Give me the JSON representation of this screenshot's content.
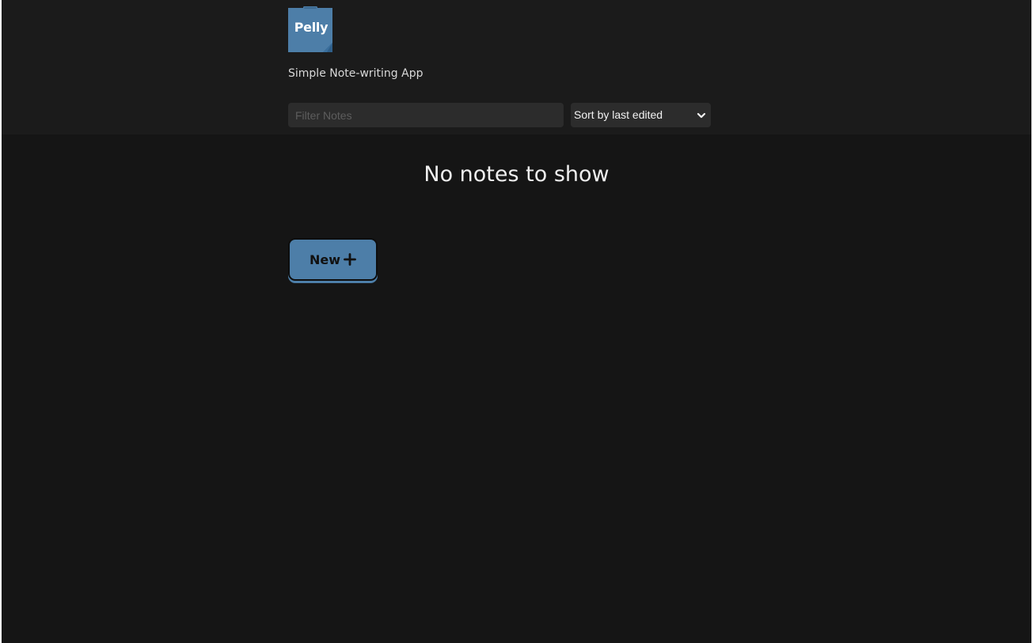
{
  "header": {
    "logo_text": "Pelly",
    "subtitle": "Simple Note-writing App"
  },
  "filter": {
    "placeholder": "Filter Notes",
    "value": ""
  },
  "sort": {
    "selected": "Sort by last edited"
  },
  "main": {
    "empty_message": "No notes to show",
    "new_button_label": "New"
  },
  "icons": {
    "logo": "pelly-logo-icon",
    "new": "plus-icon",
    "dropdown": "chevron-down-icon"
  },
  "colors": {
    "accent": "#4d7ea8",
    "background": "#151515",
    "header_background": "#1b1b1b"
  }
}
